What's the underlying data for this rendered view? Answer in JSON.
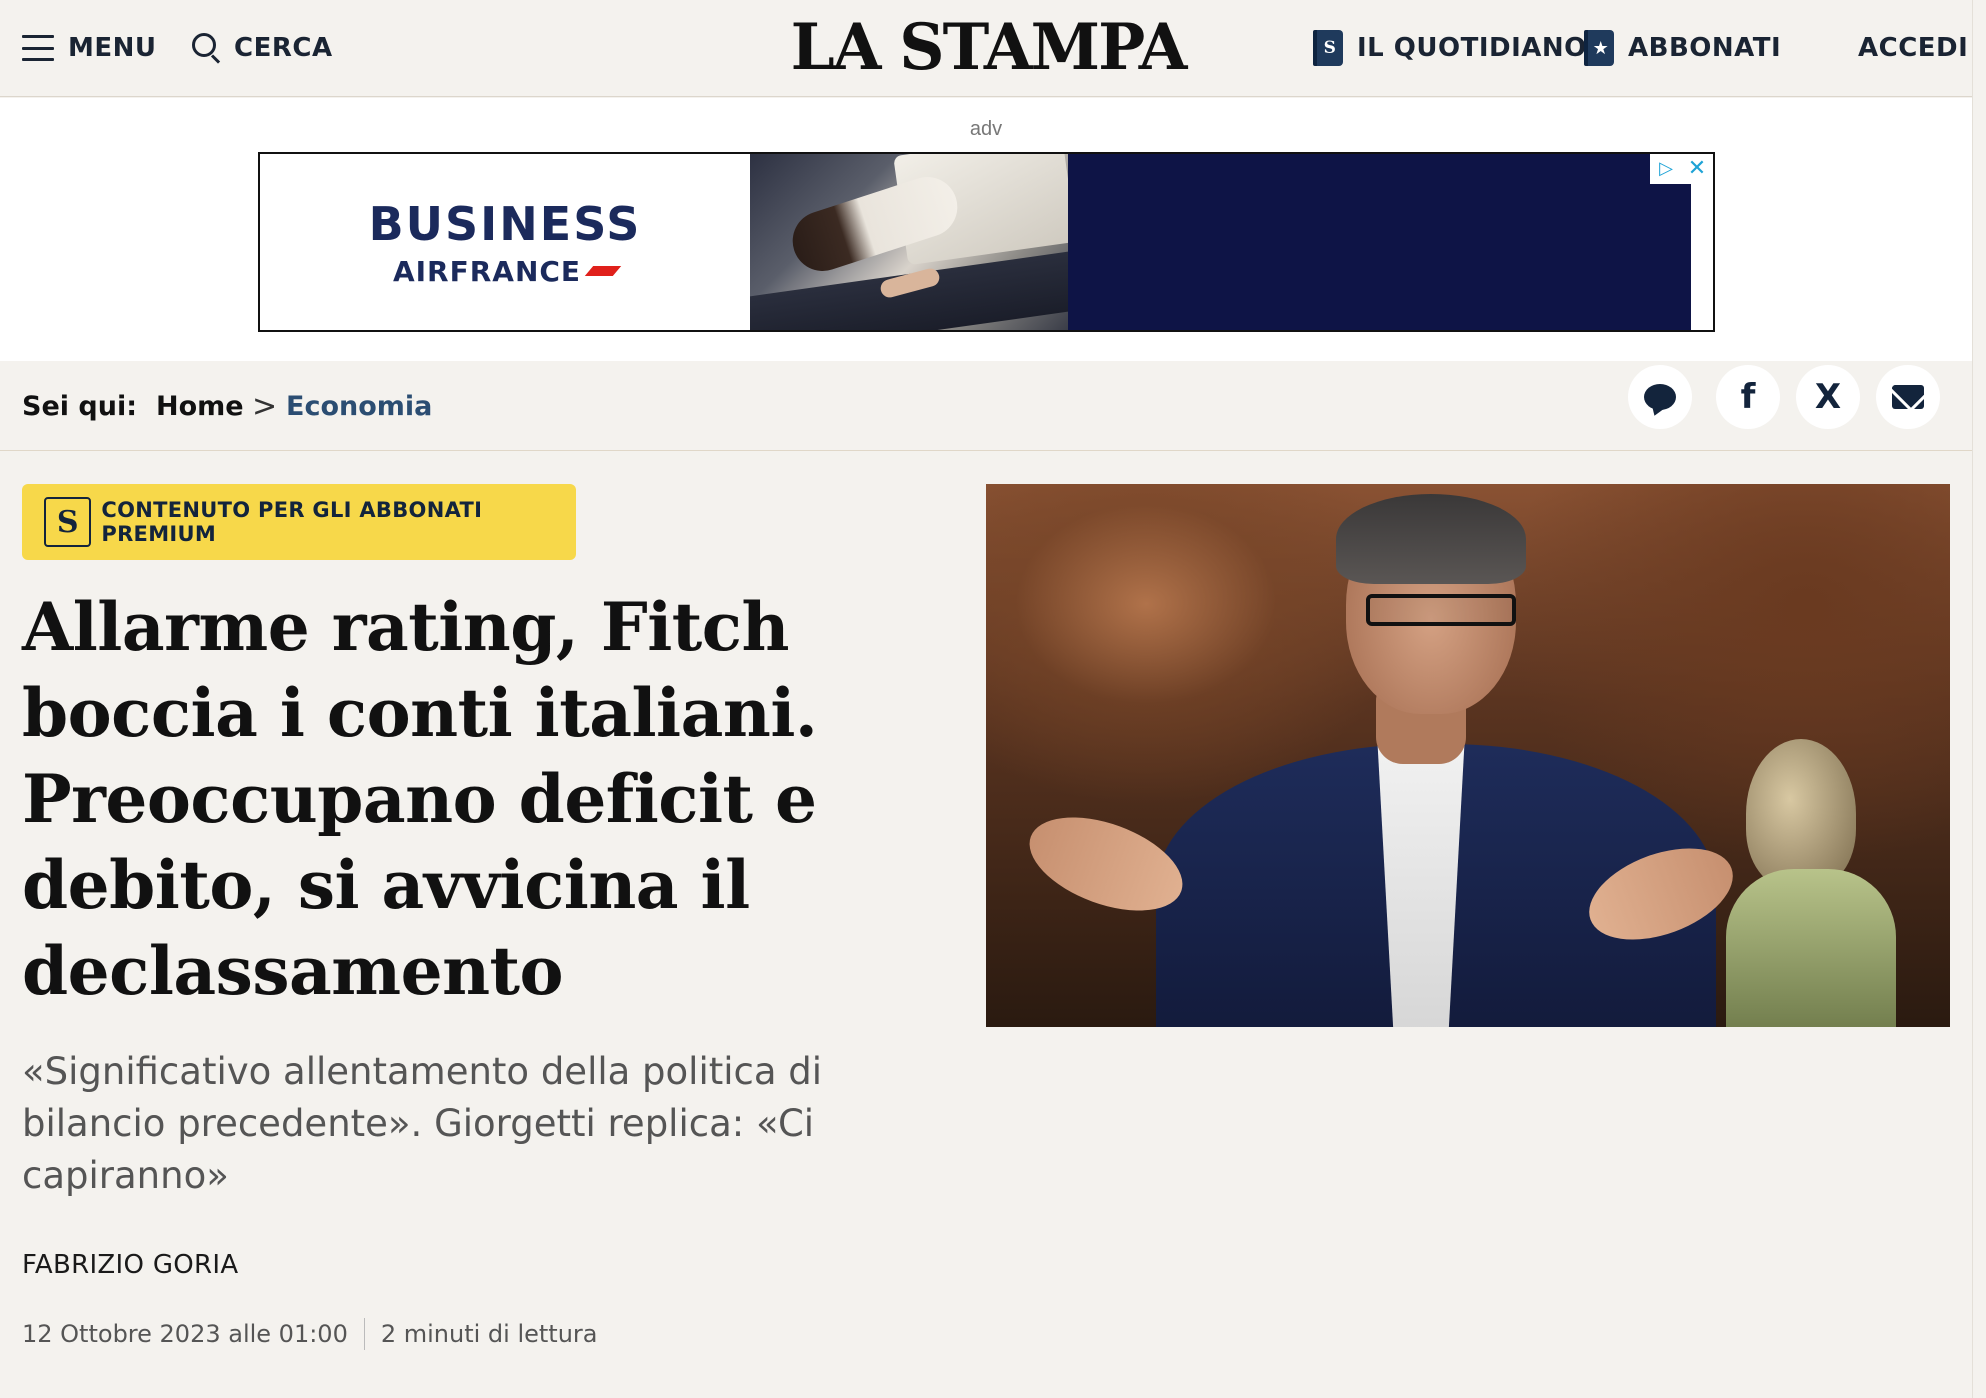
{
  "header": {
    "menu_label": "MENU",
    "search_label": "CERCA",
    "logo": "LA STAMPA",
    "quotidiano_label": "IL QUOTIDIANO",
    "quotidiano_icon_letter": "S",
    "abbonati_label": "ABBONATI",
    "abbonati_icon": "★",
    "accedi_label": "ACCEDI"
  },
  "ad": {
    "label": "adv",
    "brand_line1": "BUSINESS",
    "brand_line2": "AIRFRANCE",
    "choice_icon": "▷",
    "close_icon": "✕"
  },
  "breadcrumb": {
    "prefix": "Sei qui:",
    "home": "Home",
    "separator": ">",
    "section": "Economia"
  },
  "share": {
    "facebook_glyph": "f",
    "x_glyph": "X"
  },
  "article": {
    "premium_icon_letter": "S",
    "premium_label": "CONTENUTO PER GLI ABBONATI PREMIUM",
    "headline": "Allarme rating, Fitch boccia i conti italiani. Preoccupano deficit e debito, si avvicina il declassamento",
    "summary": "«Significativo allentamento della politica di bilancio precedente». Giorgetti replica: «Ci capiranno»",
    "author": "FABRIZIO GORIA",
    "date": "12 Ottobre 2023 alle 01:00",
    "reading_time": "2 minuti di lettura"
  },
  "colors": {
    "background": "#f4f2ee",
    "navy": "#13243c",
    "link": "#2b4d72",
    "premium": "#f7d84a",
    "ad_dark": "#0e1446"
  }
}
